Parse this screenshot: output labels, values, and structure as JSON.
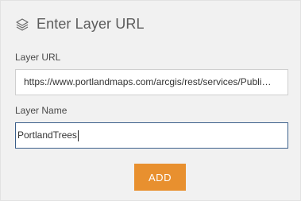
{
  "header": {
    "icon": "layers-icon",
    "title": "Enter Layer URL"
  },
  "layer_url": {
    "label": "Layer URL",
    "value": "https://www.portlandmaps.com/arcgis/rest/services/Publi…"
  },
  "layer_name": {
    "label": "Layer Name",
    "value": "PortlandTrees"
  },
  "add_button": {
    "label": "ADD"
  },
  "colors": {
    "accent": "#e8902f",
    "focus_border": "#3b5f8a",
    "panel_bg": "#f1f1f1"
  }
}
